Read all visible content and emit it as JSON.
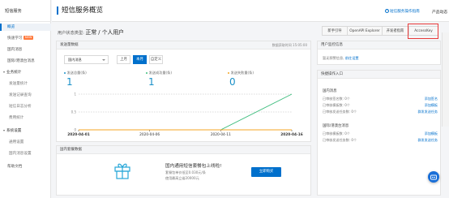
{
  "sidebar": {
    "title": "短信服务",
    "items": [
      {
        "label": "概览",
        "kind": "item",
        "active": true
      },
      {
        "label": "快速学习",
        "kind": "item",
        "badge": "NEW"
      },
      {
        "label": "国内消息",
        "kind": "item"
      },
      {
        "label": "国际/港澳台消息",
        "kind": "item"
      },
      {
        "label": "业务统计",
        "kind": "group"
      },
      {
        "label": "发送量统计",
        "kind": "sub"
      },
      {
        "label": "发送记录查询",
        "kind": "sub"
      },
      {
        "label": "短信日志分析",
        "kind": "sub"
      },
      {
        "label": "费用统计",
        "kind": "sub"
      },
      {
        "label": "系统设置",
        "kind": "group"
      },
      {
        "label": "通用设置",
        "kind": "sub"
      },
      {
        "label": "国内消息设置",
        "kind": "sub"
      },
      {
        "label": "帮助文档",
        "kind": "item"
      }
    ]
  },
  "header": {
    "title": "短信服务概览",
    "help_link": "短信服务操作指南",
    "product_menu": "产品动态"
  },
  "status": {
    "prefix": "用户状态类型:",
    "value": "正常 / 个人用户"
  },
  "tabs": [
    {
      "label": "新手引导"
    },
    {
      "label": "OpenAPI Explorer"
    },
    {
      "label": "开发者指南"
    },
    {
      "label": "AccessKey",
      "highlighted": true
    }
  ],
  "send_panel": {
    "title": "发送量数据",
    "updated": "数据获取时间 15:05:00",
    "region_select": "国内消息",
    "periods": [
      {
        "label": "上月",
        "active": false
      },
      {
        "label": "本月",
        "active": true
      },
      {
        "label": "自定义",
        "active": false
      }
    ],
    "stats": [
      {
        "label": "发送总量(条)",
        "value": "1",
        "color": "#1a90c8"
      },
      {
        "label": "发送成功量(条)",
        "value": "1",
        "color": "#3dbd7d"
      },
      {
        "label": "发送失败量(条)",
        "value": "0",
        "color": "#f5a623"
      }
    ]
  },
  "chart_data": {
    "type": "line",
    "x": [
      "2020-04-01",
      "2020-04-06",
      "2020-04-11",
      "2020-04-16"
    ],
    "y_ticks": [
      "1",
      "0.5",
      "0"
    ],
    "ylim": [
      0,
      1
    ],
    "series": [
      {
        "values": [
          0,
          0,
          0,
          1
        ],
        "color": "#3dbd7d"
      },
      {
        "values": [
          0,
          0,
          0,
          0
        ],
        "color": "#f5a623"
      }
    ]
  },
  "package_panel": {
    "title": "国内套餐数据",
    "promo_title": "国内通用短信套餐包上线啦!",
    "promo_lines": [
      "套餐包单价低至0.030元/条",
      "使用最高立省20000元"
    ],
    "promo_button": "立即购买"
  },
  "monitor_panel": {
    "title": "用户监控信息",
    "text": "暂无预警信息,",
    "link": "前往设置"
  },
  "quick_panel": {
    "title": "快捷操作入口",
    "sections": [
      {
        "title": "国内消息",
        "rows": [
          {
            "label": "已审核签名数: 0个",
            "link": "添加签名"
          },
          {
            "label": "已审核模板数: 0个",
            "link": "添加模板"
          },
          {
            "label": "已审核发送任务数: 0个",
            "link": "群发发送任务"
          }
        ]
      },
      {
        "title": "国际/港澳台消息",
        "rows": [
          {
            "label": "已审核模板数: 0个",
            "link": "添加模板"
          },
          {
            "label": "已审核发送任务数: 0个",
            "link": "群发发送任务"
          }
        ]
      }
    ]
  }
}
